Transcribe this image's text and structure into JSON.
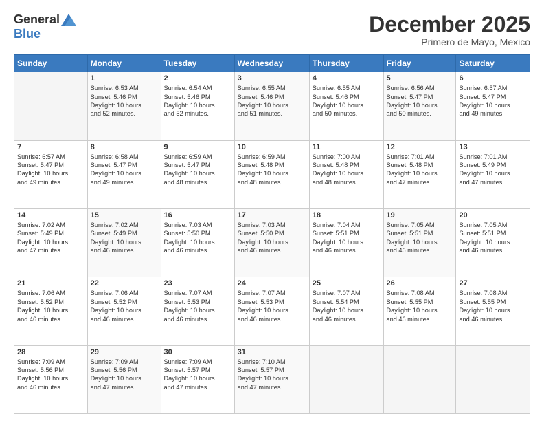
{
  "logo": {
    "general": "General",
    "blue": "Blue"
  },
  "header": {
    "month": "December 2025",
    "location": "Primero de Mayo, Mexico"
  },
  "weekdays": [
    "Sunday",
    "Monday",
    "Tuesday",
    "Wednesday",
    "Thursday",
    "Friday",
    "Saturday"
  ],
  "weeks": [
    [
      {
        "day": "",
        "content": ""
      },
      {
        "day": "1",
        "content": "Sunrise: 6:53 AM\nSunset: 5:46 PM\nDaylight: 10 hours\nand 52 minutes."
      },
      {
        "day": "2",
        "content": "Sunrise: 6:54 AM\nSunset: 5:46 PM\nDaylight: 10 hours\nand 52 minutes."
      },
      {
        "day": "3",
        "content": "Sunrise: 6:55 AM\nSunset: 5:46 PM\nDaylight: 10 hours\nand 51 minutes."
      },
      {
        "day": "4",
        "content": "Sunrise: 6:55 AM\nSunset: 5:46 PM\nDaylight: 10 hours\nand 50 minutes."
      },
      {
        "day": "5",
        "content": "Sunrise: 6:56 AM\nSunset: 5:47 PM\nDaylight: 10 hours\nand 50 minutes."
      },
      {
        "day": "6",
        "content": "Sunrise: 6:57 AM\nSunset: 5:47 PM\nDaylight: 10 hours\nand 49 minutes."
      }
    ],
    [
      {
        "day": "7",
        "content": "Sunrise: 6:57 AM\nSunset: 5:47 PM\nDaylight: 10 hours\nand 49 minutes."
      },
      {
        "day": "8",
        "content": "Sunrise: 6:58 AM\nSunset: 5:47 PM\nDaylight: 10 hours\nand 49 minutes."
      },
      {
        "day": "9",
        "content": "Sunrise: 6:59 AM\nSunset: 5:47 PM\nDaylight: 10 hours\nand 48 minutes."
      },
      {
        "day": "10",
        "content": "Sunrise: 6:59 AM\nSunset: 5:48 PM\nDaylight: 10 hours\nand 48 minutes."
      },
      {
        "day": "11",
        "content": "Sunrise: 7:00 AM\nSunset: 5:48 PM\nDaylight: 10 hours\nand 48 minutes."
      },
      {
        "day": "12",
        "content": "Sunrise: 7:01 AM\nSunset: 5:48 PM\nDaylight: 10 hours\nand 47 minutes."
      },
      {
        "day": "13",
        "content": "Sunrise: 7:01 AM\nSunset: 5:49 PM\nDaylight: 10 hours\nand 47 minutes."
      }
    ],
    [
      {
        "day": "14",
        "content": "Sunrise: 7:02 AM\nSunset: 5:49 PM\nDaylight: 10 hours\nand 47 minutes."
      },
      {
        "day": "15",
        "content": "Sunrise: 7:02 AM\nSunset: 5:49 PM\nDaylight: 10 hours\nand 46 minutes."
      },
      {
        "day": "16",
        "content": "Sunrise: 7:03 AM\nSunset: 5:50 PM\nDaylight: 10 hours\nand 46 minutes."
      },
      {
        "day": "17",
        "content": "Sunrise: 7:03 AM\nSunset: 5:50 PM\nDaylight: 10 hours\nand 46 minutes."
      },
      {
        "day": "18",
        "content": "Sunrise: 7:04 AM\nSunset: 5:51 PM\nDaylight: 10 hours\nand 46 minutes."
      },
      {
        "day": "19",
        "content": "Sunrise: 7:05 AM\nSunset: 5:51 PM\nDaylight: 10 hours\nand 46 minutes."
      },
      {
        "day": "20",
        "content": "Sunrise: 7:05 AM\nSunset: 5:51 PM\nDaylight: 10 hours\nand 46 minutes."
      }
    ],
    [
      {
        "day": "21",
        "content": "Sunrise: 7:06 AM\nSunset: 5:52 PM\nDaylight: 10 hours\nand 46 minutes."
      },
      {
        "day": "22",
        "content": "Sunrise: 7:06 AM\nSunset: 5:52 PM\nDaylight: 10 hours\nand 46 minutes."
      },
      {
        "day": "23",
        "content": "Sunrise: 7:07 AM\nSunset: 5:53 PM\nDaylight: 10 hours\nand 46 minutes."
      },
      {
        "day": "24",
        "content": "Sunrise: 7:07 AM\nSunset: 5:53 PM\nDaylight: 10 hours\nand 46 minutes."
      },
      {
        "day": "25",
        "content": "Sunrise: 7:07 AM\nSunset: 5:54 PM\nDaylight: 10 hours\nand 46 minutes."
      },
      {
        "day": "26",
        "content": "Sunrise: 7:08 AM\nSunset: 5:55 PM\nDaylight: 10 hours\nand 46 minutes."
      },
      {
        "day": "27",
        "content": "Sunrise: 7:08 AM\nSunset: 5:55 PM\nDaylight: 10 hours\nand 46 minutes."
      }
    ],
    [
      {
        "day": "28",
        "content": "Sunrise: 7:09 AM\nSunset: 5:56 PM\nDaylight: 10 hours\nand 46 minutes."
      },
      {
        "day": "29",
        "content": "Sunrise: 7:09 AM\nSunset: 5:56 PM\nDaylight: 10 hours\nand 47 minutes."
      },
      {
        "day": "30",
        "content": "Sunrise: 7:09 AM\nSunset: 5:57 PM\nDaylight: 10 hours\nand 47 minutes."
      },
      {
        "day": "31",
        "content": "Sunrise: 7:10 AM\nSunset: 5:57 PM\nDaylight: 10 hours\nand 47 minutes."
      },
      {
        "day": "",
        "content": ""
      },
      {
        "day": "",
        "content": ""
      },
      {
        "day": "",
        "content": ""
      }
    ]
  ]
}
